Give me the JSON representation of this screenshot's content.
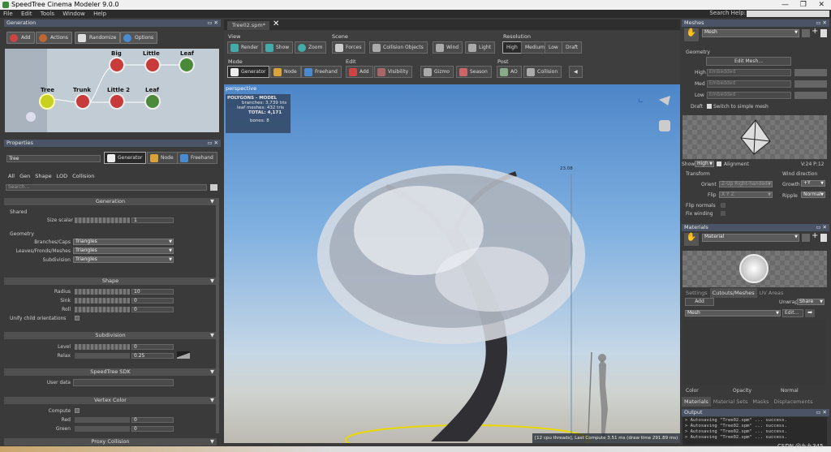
{
  "app": {
    "title": "SpeedTree Cinema Modeler 9.0.0",
    "search_help": "Search Help:"
  },
  "menu": [
    "File",
    "Edit",
    "Tools",
    "Window",
    "Help"
  ],
  "generation": {
    "panel_title": "Generation",
    "buttons": {
      "add": "Add",
      "actions": "Actions",
      "randomize": "Randomize",
      "options": "Options"
    },
    "nodes": {
      "big": "Big",
      "little": "Little",
      "leaf1": "Leaf",
      "tree": "Tree",
      "trunk": "Trunk",
      "little2": "Little 2",
      "leaf2": "Leaf"
    }
  },
  "properties": {
    "panel_title": "Properties",
    "name_value": "Tree",
    "mode_buttons": {
      "generator": "Generator",
      "node": "Node",
      "freehand": "Freehand"
    },
    "tabs": [
      "All",
      "Gen",
      "Shape",
      "LOD",
      "Collision"
    ],
    "search_placeholder": "Search...",
    "generation": {
      "title": "Generation",
      "shared_label": "Shared",
      "size_scalar_label": "Size scalar",
      "size_scalar_value": "1",
      "geometry_label": "Geometry",
      "branches_caps_label": "Branches/Caps",
      "branches_caps_value": "Triangles",
      "leaves_label": "Leaves/Fronds/Meshes",
      "leaves_value": "Triangles",
      "subdivision_label": "Subdivision",
      "subdivision_value": "Triangles"
    },
    "shape": {
      "title": "Shape",
      "radius_label": "Radius",
      "radius_value": "10",
      "sink_label": "Sink",
      "sink_value": "0",
      "roll_label": "Roll",
      "roll_value": "0",
      "unify_label": "Unify child orientations"
    },
    "subdivision": {
      "title": "Subdivision",
      "level_label": "Level",
      "level_value": "0",
      "relax_label": "Relax",
      "relax_value": "0.25"
    },
    "sdk": {
      "title": "SpeedTree SDK",
      "user_data_label": "User data"
    },
    "vertex_color": {
      "title": "Vertex Color",
      "compute_label": "Compute",
      "red_label": "Red",
      "red_value": "0",
      "green_label": "Green",
      "green_value": "0"
    },
    "proxy": {
      "title": "Proxy Collision"
    }
  },
  "document": {
    "tab": "Tree02.spm*",
    "close": "✕"
  },
  "toolbar": {
    "view_label": "View",
    "view": {
      "render": "Render",
      "show": "Show",
      "zoom": "Zoom"
    },
    "scene_label": "Scene",
    "scene": {
      "forces": "Forces",
      "collision": "Collision Objects",
      "wind": "Wind",
      "light": "Light"
    },
    "resolution_label": "Resolution",
    "resolution": [
      "High",
      "Medium",
      "Low",
      "Draft"
    ],
    "mode_label": "Mode",
    "mode": {
      "generator": "Generator",
      "node": "Node",
      "freehand": "Freehand"
    },
    "edit_label": "Edit",
    "edit": {
      "add": "Add",
      "visibility": "Visibility",
      "gizmo": "Gizmo",
      "season": "Season"
    },
    "post_label": "Post",
    "post": {
      "ao": "AO",
      "collision": "Collision"
    }
  },
  "viewport": {
    "label": "perspective",
    "stats": {
      "title": "POLYGONS - MODEL",
      "branches_label": "branches:",
      "branches_value": "3,739 tris",
      "leaf_meshes_label": "leaf meshes:",
      "leaf_meshes_value": "432 tris",
      "total_label": "TOTAL:",
      "total_value": "4,171",
      "bones_label": "bones:",
      "bones_value": "8"
    },
    "height_marker": "23.08",
    "status": "[12 cpu threads], Last Compute 3.51 ms (draw time 291.89 ms)"
  },
  "meshes": {
    "panel_title": "Meshes",
    "mesh_value": "Mesh",
    "geometry_label": "Geometry",
    "edit_mesh": "Edit Mesh...",
    "lods": [
      {
        "label": "High",
        "value": "Embedded"
      },
      {
        "label": "Med",
        "value": "Embedded"
      },
      {
        "label": "Low",
        "value": "Embedded"
      }
    ],
    "draft_label": "Draft",
    "switch_label": "Switch to simple mesh",
    "show_label": "Show",
    "show_value": "High",
    "alignment_label": "Alignment",
    "vp_label": "V:24  P:12",
    "transform_label": "Transform",
    "orient_label": "Orient",
    "orient_value": "Z-Up Right-handed",
    "flip_label": "Flip",
    "flip_value": "X Y Z",
    "flip_normals_label": "Flip normals",
    "fix_winding_label": "Fix winding",
    "wind_direction_label": "Wind direction",
    "growth_label": "Growth",
    "growth_value": "+Y",
    "ripple_label": "Ripple",
    "ripple_value": "Normal"
  },
  "materials": {
    "panel_title": "Materials",
    "material_value": "Material",
    "tabs": [
      "Settings",
      "Cutouts/Meshes",
      "UV Areas"
    ],
    "add": "Add",
    "unwrap_label": "Unwrap",
    "unwrap_value": "Share",
    "mesh_value": "Mesh",
    "edit_button": "Edit...",
    "color_label": "Color",
    "opacity_label": "Opacity",
    "normal_label": "Normal",
    "bottom_tabs": [
      "Materials",
      "Material Sets",
      "Masks",
      "Displacements"
    ]
  },
  "output": {
    "panel_title": "Output",
    "lines": [
      "> Autosaving \"Tree02.spm\" ... success.",
      "> Autosaving \"Tree02.spm\" ... success.",
      "> Autosaving \"Tree02.spm\" ... success.",
      "> Autosaving \"Tree02.spm\" ... success."
    ]
  },
  "watermark": "CSDN @九九345"
}
